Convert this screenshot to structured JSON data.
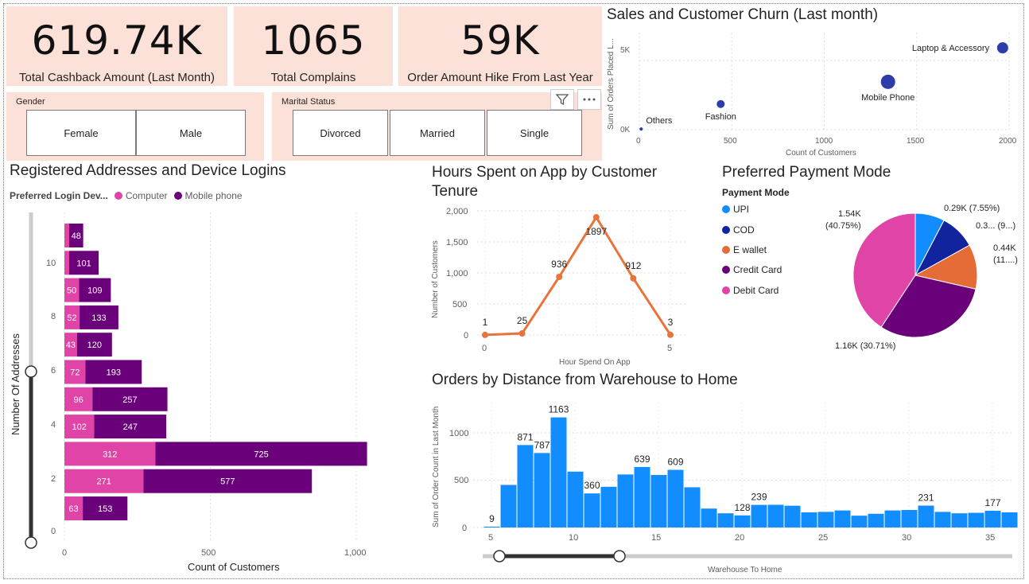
{
  "kpis": [
    {
      "value": "619.74K",
      "label": "Total Cashback Amount (Last Month)"
    },
    {
      "value": "1065",
      "label": "Total Complains"
    },
    {
      "value": "59K",
      "label": "Order Amount Hike From Last Year"
    }
  ],
  "slicers": {
    "gender": {
      "title": "Gender",
      "options": [
        "Female",
        "Male"
      ]
    },
    "marital": {
      "title": "Marital Status",
      "options": [
        "Divorced",
        "Married",
        "Single"
      ]
    }
  },
  "icons": {
    "filter": "filter-icon",
    "more": "more-options-icon"
  },
  "colors": {
    "computer": "#e044a7",
    "mobile": "#6b007b",
    "line": "#e8743b",
    "hist": "#118dff",
    "scatter": "#2e3ca9"
  },
  "scatter": {
    "title": "Sales and Customer Churn (Last month)",
    "xlabel": "Count of Customers",
    "ylabel": "Sum of Orders Placed L...",
    "xticks": [
      "0",
      "500",
      "1000",
      "1500",
      "2000"
    ],
    "yticks": [
      "0K",
      "5K"
    ]
  },
  "bar": {
    "title": "Registered Addresses and Device Logins",
    "legend_title": "Preferred Login Dev...",
    "legend": [
      "Computer",
      "Mobile phone"
    ],
    "xlabel": "Count of Customers",
    "ylabel": "Number Of Addresses",
    "xticks": [
      "0",
      "500",
      "1,000"
    ],
    "yticks": [
      "10",
      "8",
      "6",
      "4",
      "2",
      "0"
    ]
  },
  "line": {
    "title_1": "Hours Spent on App by Customer",
    "title_2": "Tenure",
    "xlabel": "Hour Spend On App",
    "ylabel": "Number of Customers",
    "yticks": [
      "2,000",
      "1,500",
      "1,000",
      "500",
      "0"
    ],
    "xticks": [
      "0",
      "5"
    ]
  },
  "pie": {
    "title": "Preferred Payment Mode",
    "legend_title": "Payment Mode",
    "labels": [
      "0.29K (7.55%)",
      "0.3... (9...)",
      "0.44K",
      "(11....)",
      "1.16K (30.71%)",
      "1.54K",
      "(40.75%)"
    ]
  },
  "hist": {
    "title": "Orders by Distance from Warehouse to Home",
    "xlabel": "Warehouse To Home",
    "ylabel": "Sum of Order Count in Last Month",
    "yticks": [
      "1000",
      "500",
      "0"
    ],
    "xticks": [
      "5",
      "10",
      "15",
      "20",
      "25",
      "30",
      "35"
    ]
  },
  "chart_data": [
    {
      "type": "scatter",
      "title": "Sales and Customer Churn (Last month)",
      "xlabel": "Count of Customers",
      "ylabel": "Sum of Orders Placed L...",
      "xlim": [
        0,
        2000
      ],
      "ylim": [
        0,
        7000
      ],
      "points": [
        {
          "label": "Others",
          "x": 10,
          "y": 50,
          "size": 2
        },
        {
          "label": "Fashion",
          "x": 440,
          "y": 1850,
          "size": 5
        },
        {
          "label": "Mobile Phone",
          "x": 1345,
          "y": 3450,
          "size": 9
        },
        {
          "label": "Laptop & Accessory",
          "x": 1965,
          "y": 5900,
          "size": 7
        }
      ]
    },
    {
      "type": "bar",
      "orientation": "horizontal-stacked",
      "title": "Registered Addresses and Device Logins",
      "xlabel": "Count of Customers",
      "ylabel": "Number Of Addresses",
      "xlim": [
        0,
        1150
      ],
      "legend_title": "Preferred Login Dev...",
      "categories": [
        11,
        10,
        9,
        8,
        7,
        6,
        5,
        4,
        3,
        2,
        1
      ],
      "series": [
        {
          "name": "Computer",
          "values": [
            0,
            0,
            50,
            52,
            43,
            72,
            96,
            102,
            312,
            271,
            63
          ],
          "labels": [
            "",
            "",
            "50",
            "52",
            "43",
            "72",
            "96",
            "102",
            "312",
            "271",
            "63"
          ]
        },
        {
          "name": "Mobile phone",
          "values": [
            48,
            101,
            109,
            133,
            120,
            193,
            257,
            247,
            725,
            577,
            153
          ],
          "labels": [
            "48",
            "101",
            "109",
            "133",
            "120",
            "193",
            "257",
            "247",
            "725",
            "577",
            "153"
          ]
        }
      ]
    },
    {
      "type": "line",
      "title": "Hours Spent on App by Customer Tenure",
      "xlabel": "Hour Spend On App",
      "ylabel": "Number of Customers",
      "x": [
        0,
        1,
        2,
        3,
        4,
        5
      ],
      "values": [
        1,
        25,
        936,
        1897,
        912,
        3
      ],
      "ylim": [
        0,
        2000
      ]
    },
    {
      "type": "pie",
      "title": "Preferred Payment Mode",
      "legend_title": "Payment Mode",
      "categories": [
        "UPI",
        "COD",
        "E wallet",
        "Credit Card",
        "Debit Card"
      ],
      "values": [
        0.29,
        0.35,
        0.44,
        1.16,
        1.54
      ],
      "colors": [
        "#118dff",
        "#12239e",
        "#e66c37",
        "#6b007b",
        "#e044a7"
      ]
    },
    {
      "type": "bar",
      "title": "Orders by Distance from Warehouse to Home",
      "xlabel": "Warehouse To Home",
      "ylabel": "Sum of Order Count in Last Month",
      "ylim": [
        0,
        1250
      ],
      "x": [
        5,
        6,
        7,
        8,
        9,
        10,
        11,
        12,
        13,
        14,
        15,
        16,
        17,
        18,
        19,
        20,
        21,
        22,
        23,
        24,
        25,
        26,
        27,
        28,
        29,
        30,
        31,
        32,
        33,
        34,
        35,
        36
      ],
      "values": [
        9,
        450,
        871,
        787,
        1163,
        590,
        360,
        430,
        560,
        639,
        555,
        609,
        425,
        200,
        150,
        128,
        239,
        240,
        230,
        160,
        165,
        180,
        125,
        145,
        180,
        185,
        231,
        165,
        150,
        155,
        177,
        160
      ],
      "labels": {
        "5": "9",
        "7": "871",
        "8": "787",
        "9": "1163",
        "11": "360",
        "14": "639",
        "16": "609",
        "20": "128",
        "21": "239",
        "31": "231",
        "35": "177"
      }
    }
  ]
}
